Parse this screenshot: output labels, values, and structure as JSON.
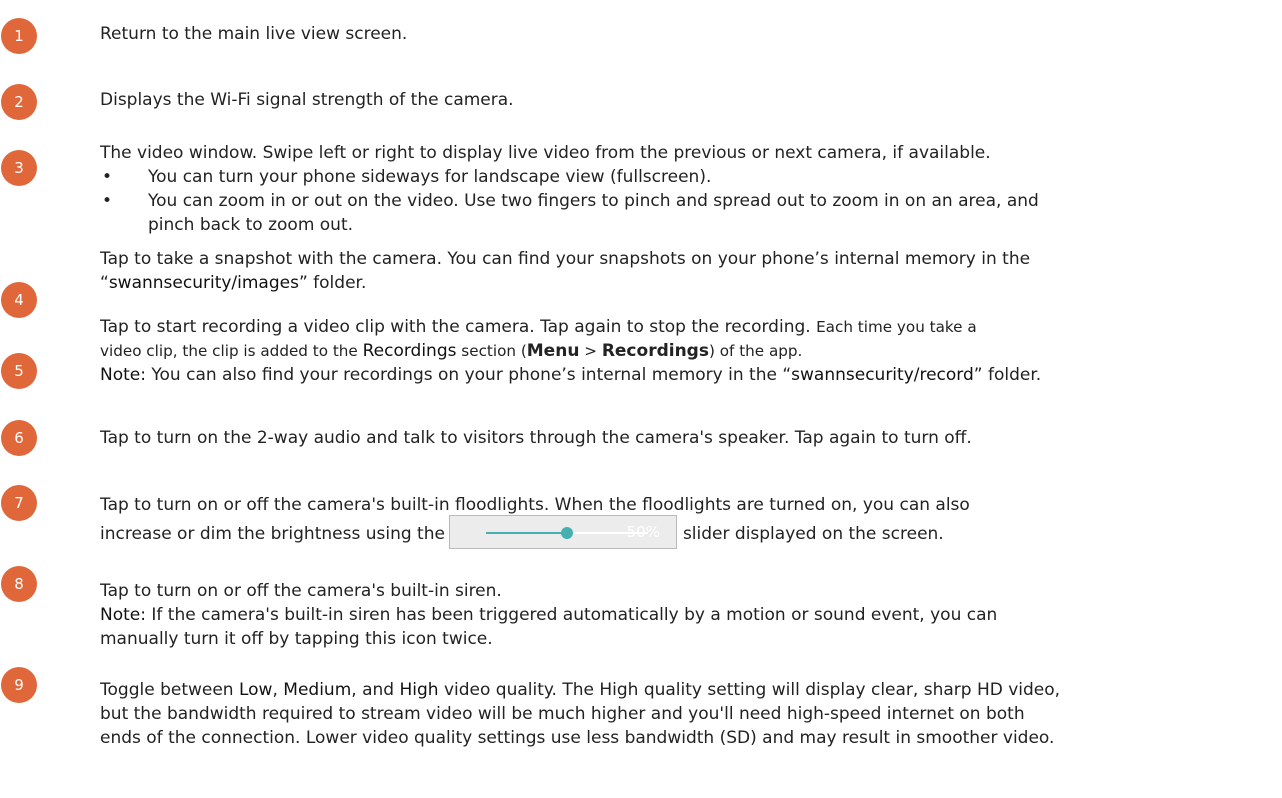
{
  "accent_color": "#e0673a",
  "items": [
    {
      "number": "1",
      "text": "Return to the main live view screen."
    },
    {
      "number": "2",
      "text": "Displays the Wi-Fi signal strength of the camera."
    },
    {
      "number": "3",
      "text": "The video window. Swipe left or right to display live video from the previous or next camera, if available.",
      "bullets": [
        "You can turn your phone sideways for landscape view (fullscreen).",
        "You can zoom in or out on the video. Use two fingers to pinch and spread out to zoom in on an area, and",
        "pinch back to zoom out."
      ]
    },
    {
      "number": "4",
      "line1": "Tap to take a snapshot with the camera. You can find your snapshots on your phone’s internal memory in the",
      "open_quote": "“",
      "folder": "swannsecurity/images",
      "close": "” folder."
    },
    {
      "number": "5",
      "line1_a": "Tap to start recording a video clip with the camera. Tap again to stop the recording. ",
      "line1_b": "Each time you take a",
      "line2_a": "video clip, the clip is added to the ",
      "recordings": "Recordings",
      "line2_b": " section (",
      "menu": "Menu",
      "gt": " > ",
      "recordings2": "Recordings",
      "line2_c": ") of the app.",
      "note_label": "Note:",
      "note_text": " You can also find your recordings on your phone’s internal memory in the “",
      "folder": "swannsecurity/record",
      "note_end": "” folder."
    },
    {
      "number": "6",
      "text": "Tap to turn on the 2-way audio and talk to visitors through the camera's speaker. Tap again to turn off."
    },
    {
      "number": "7",
      "line1": "Tap to turn on or off the camera's built-in floodlights. When the floodlights are turned on, you can also",
      "line2_a": "increase or dim the brightness using the",
      "slider_value": "50%",
      "slider_level": 0.5,
      "line2_b": "slider displayed on the screen."
    },
    {
      "number": "8",
      "line1": "Tap to turn on or off the camera's built-in siren.",
      "note_label": "Note:",
      "note_line1": " If the camera's built-in siren has been triggered automatically by a motion or sound event, you can",
      "note_line2": "manually turn it off by tapping this icon twice."
    },
    {
      "number": "9",
      "line1_a": "Toggle between ",
      "low": "Low",
      "sep1": ", ",
      "medium": "Medium",
      "sep2": ", and ",
      "high": "High",
      "line1_b": " video quality. The High quality setting will display clear, sharp HD video,",
      "line2": "but the bandwidth required to stream video will be much higher and you'll need high-speed internet on both",
      "line3": "ends of the connection. Lower video quality settings use less bandwidth (SD) and may result in smoother video."
    }
  ]
}
